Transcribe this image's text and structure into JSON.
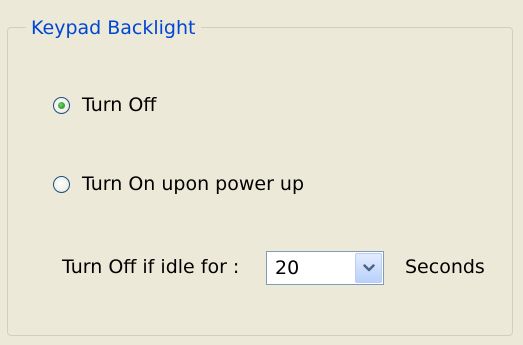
{
  "group": {
    "title": "Keypad Backlight"
  },
  "options": [
    {
      "label": "Turn Off",
      "selected": true
    },
    {
      "label": "Turn On upon power up",
      "selected": false
    }
  ],
  "idle": {
    "label": "Turn Off if idle for :",
    "value": "20",
    "unit_label": "Seconds"
  },
  "colors": {
    "title": "#0046d5",
    "background": "#ece9d8",
    "radio_dot": "#2f9a2f"
  },
  "icons": {
    "dropdown": "chevron-down-icon"
  }
}
